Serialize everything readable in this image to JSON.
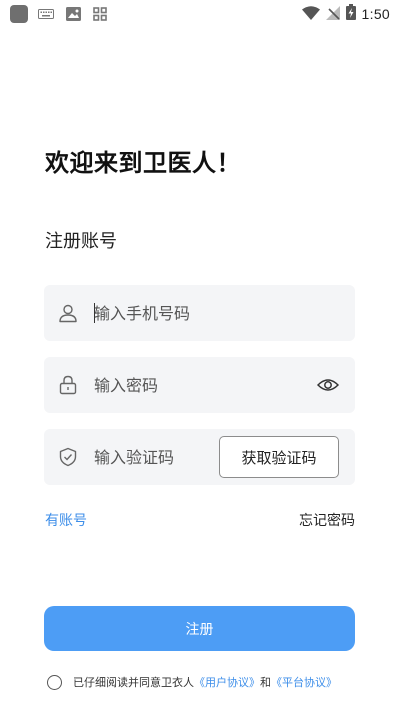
{
  "status_bar": {
    "time": "1:50",
    "icons": [
      "app-icon",
      "keyboard-icon",
      "image-icon",
      "grid-icon",
      "wifi-icon",
      "no-signal-icon",
      "battery-charging-icon"
    ]
  },
  "header": {
    "title": "欢迎来到卫医人！",
    "subtitle": "注册账号"
  },
  "form": {
    "phone_placeholder": "输入手机号码",
    "password_placeholder": "输入密码",
    "code_placeholder": "输入验证码",
    "get_code_label": "获取验证码"
  },
  "links": {
    "have_account": "有账号",
    "forgot_password": "忘记密码"
  },
  "register_label": "注册",
  "agreement": {
    "prefix": "已仔细阅读并同意卫衣人",
    "user_agreement": "《用户协议》",
    "and": "和",
    "platform_agreement": "《平台协议》"
  },
  "colors": {
    "accent": "#4d9df5",
    "link": "#3d8ee9",
    "field_bg": "#f4f5f7"
  }
}
